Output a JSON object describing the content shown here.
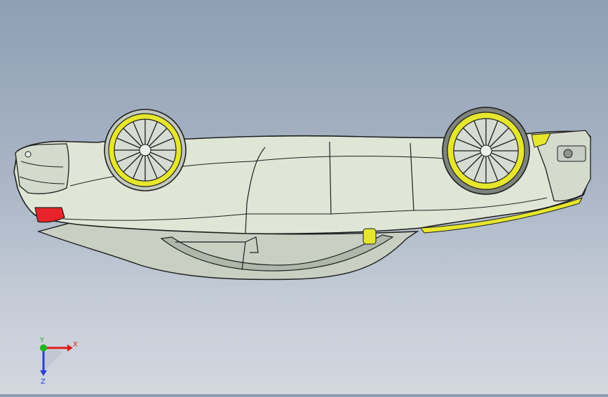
{
  "viewport": {
    "background_top": "#8e9fb4",
    "background_bottom": "#d3d8df",
    "model_body_color": "#dfe6d6",
    "rim_color": "#e6e62e",
    "tail_light_color": "#e8242a"
  },
  "triad": {
    "x_label": "X",
    "y_label": "Y",
    "z_label": "Z",
    "x_color": "#e01b1b",
    "y_color": "#1fb51f",
    "z_color": "#2a3fd6"
  }
}
